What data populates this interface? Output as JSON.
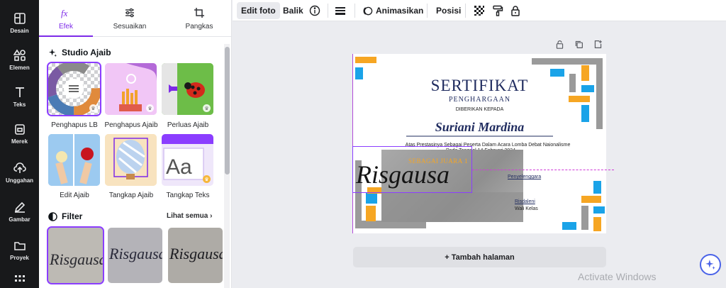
{
  "rail": [
    {
      "label": "Desain",
      "icon": "layout-icon"
    },
    {
      "label": "Elemen",
      "icon": "shapes-icon"
    },
    {
      "label": "Teks",
      "icon": "text-icon"
    },
    {
      "label": "Merek",
      "icon": "brand-icon"
    },
    {
      "label": "Unggahan",
      "icon": "upload-icon"
    },
    {
      "label": "Gambar",
      "icon": "draw-icon"
    },
    {
      "label": "Proyek",
      "icon": "folder-icon"
    }
  ],
  "panel": {
    "tabs": [
      {
        "label": "Efek",
        "icon": "fx-icon",
        "active": true
      },
      {
        "label": "Sesuaikan",
        "icon": "sliders-icon"
      },
      {
        "label": "Pangkas",
        "icon": "crop-icon"
      }
    ],
    "studio_title": "Studio Ajaib",
    "tools": [
      {
        "label": "Penghapus LB"
      },
      {
        "label": "Penghapus Ajaib"
      },
      {
        "label": "Perluas Ajaib"
      },
      {
        "label": "Edit Ajaib"
      },
      {
        "label": "Tangkap Ajaib"
      },
      {
        "label": "Tangkap Teks"
      }
    ],
    "filter_title": "Filter",
    "see_all": "Lihat semua",
    "filter_sample_text": "Risgausa"
  },
  "toolbar": {
    "edit_foto": "Edit foto",
    "balik": "Balik",
    "animasikan": "Animasikan",
    "posisi": "Posisi"
  },
  "certificate": {
    "title": "SERTIFIKAT",
    "subtitle": "PENGHARGAAN",
    "given_to": "DIBERIKAN KEPADA",
    "name": "Suriani Mardina",
    "line1": "Atas Prestasinya Sebagai Peserta Dalam Acara Lomba Debat Naionalisme",
    "line2": "Pada Tanggal 14 Februari 2024",
    "rank": "SEBAGAI JUARA 1",
    "organizer": "Penyelenggara",
    "signer_name": "Risdaleni",
    "signer_role": "Wali Kelas",
    "signature_text": "Risgausa"
  },
  "add_page": "+ Tambah halaman",
  "watermark": "Activate Windows",
  "colors": {
    "accent": "#8b3dff",
    "rail_bg": "#18191b",
    "cert_navy": "#1e2a5e",
    "deco_orange": "#f6a623",
    "deco_blue": "#1aa3e8",
    "deco_gray": "#9a9a9a"
  }
}
